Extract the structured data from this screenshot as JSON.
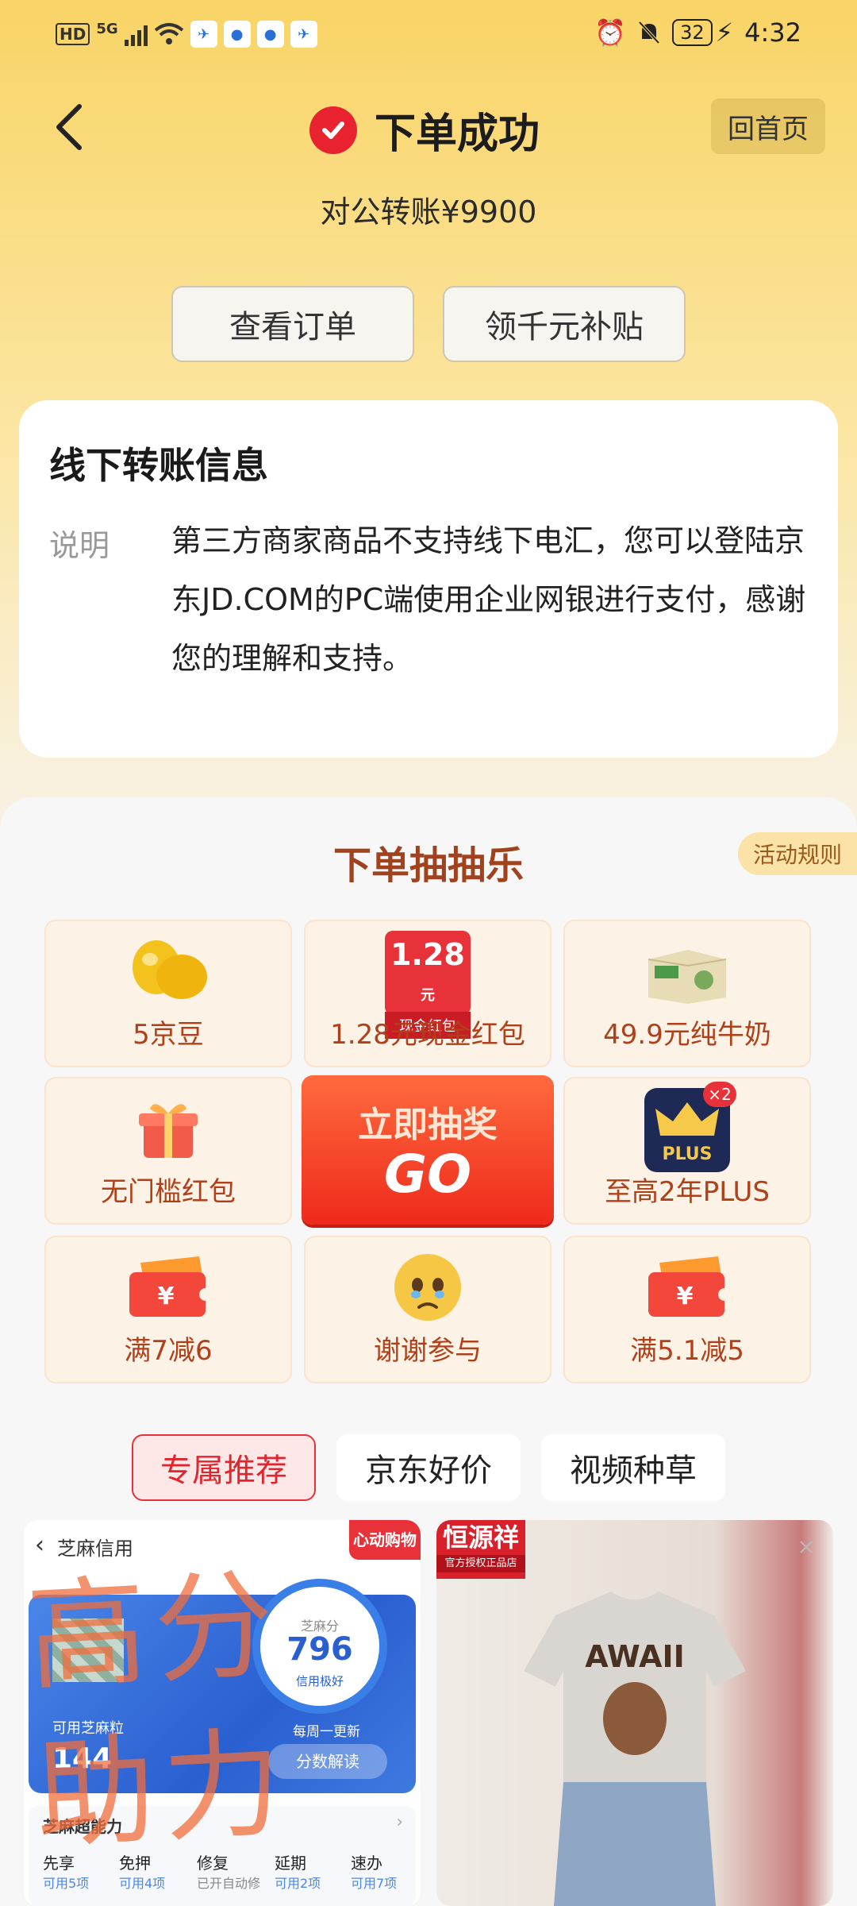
{
  "status_bar": {
    "hd": "HD",
    "network": "5G",
    "battery": "32",
    "time": "4:32"
  },
  "header": {
    "title": "下单成功",
    "home_button": "回首页",
    "payment_line": "对公转账¥9900"
  },
  "actions": {
    "view_order": "查看订单",
    "get_subsidy": "领千元补贴"
  },
  "transfer_info": {
    "title": "线下转账信息",
    "label": "说明",
    "text": "第三方商家商品不支持线下电汇，您可以登陆京东JD.COM的PC端使用企业网银进行支付，感谢您的理解和支持。"
  },
  "lottery": {
    "title": "下单抽抽乐",
    "rules": "活动规则",
    "prizes": [
      {
        "label": "5京豆",
        "icon": "bean-icon"
      },
      {
        "label": "1.28元现金红包",
        "icon": "red-packet-icon",
        "badge_amount": "1.28",
        "badge_unit": "元",
        "badge_sub": "现金红包"
      },
      {
        "label": "49.9元纯牛奶",
        "icon": "milk-box-icon"
      },
      {
        "label": "无门槛红包",
        "icon": "gift-box-icon"
      },
      {
        "label": "至高2年PLUS",
        "icon": "plus-crown-icon",
        "badge": "×2",
        "plus_text": "PLUS"
      },
      {
        "label": "满7减6",
        "icon": "coupon-icon"
      },
      {
        "label": "谢谢参与",
        "icon": "sad-face-icon"
      },
      {
        "label": "满5.1减5",
        "icon": "coupon-icon"
      }
    ],
    "go_line1": "立即抽奖",
    "go_line2": "GO"
  },
  "tabs": [
    {
      "label": "专属推荐",
      "active": true
    },
    {
      "label": "京东好价",
      "active": false
    },
    {
      "label": "视频种草",
      "active": false
    }
  ],
  "feed": {
    "left": {
      "header": "芝麻信用",
      "tag": "心动购物季",
      "score_label": "芝麻分",
      "score": "796",
      "score_status": "信用极好",
      "weekly": "每周一更新",
      "analyze_btn": "分数解读",
      "available_label": "可用芝麻粒",
      "available_value": "144",
      "super_label": "芝麻超能力",
      "powers": [
        {
          "name": "先享",
          "sub": "可用5项"
        },
        {
          "name": "免押",
          "sub": "可用4项"
        },
        {
          "name": "修复",
          "sub": "已开自动修"
        },
        {
          "name": "延期",
          "sub": "可用2项"
        },
        {
          "name": "速办",
          "sub": "可用7项"
        }
      ],
      "handwriting": "高分助力"
    },
    "right": {
      "brand": "恒源祥",
      "brand_sub": "官方授权正品店",
      "shirt_text": "AWAII"
    }
  },
  "colors": {
    "accent_red": "#e8232f",
    "gold_bg": "#f9d466",
    "prize_text": "#b0401a"
  }
}
